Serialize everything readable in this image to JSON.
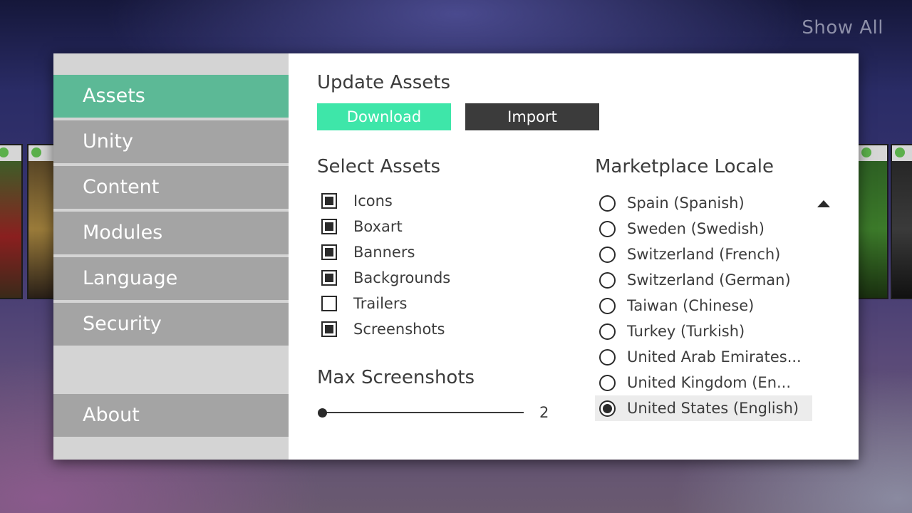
{
  "header": {
    "show_all": "Show All"
  },
  "sidebar": {
    "items": [
      {
        "label": "Assets"
      },
      {
        "label": "Unity"
      },
      {
        "label": "Content"
      },
      {
        "label": "Modules"
      },
      {
        "label": "Language"
      },
      {
        "label": "Security"
      }
    ],
    "about": "About"
  },
  "update_assets": {
    "title": "Update Assets",
    "download_label": "Download",
    "import_label": "Import"
  },
  "select_assets": {
    "title": "Select Assets",
    "items": [
      {
        "label": "Icons",
        "checked": true
      },
      {
        "label": "Boxart",
        "checked": true
      },
      {
        "label": "Banners",
        "checked": true
      },
      {
        "label": "Backgrounds",
        "checked": true
      },
      {
        "label": "Trailers",
        "checked": false
      },
      {
        "label": "Screenshots",
        "checked": true
      }
    ]
  },
  "max_screenshots": {
    "title": "Max Screenshots",
    "value": "2"
  },
  "marketplace_locale": {
    "title": "Marketplace Locale",
    "options": [
      {
        "label": "Spain (Spanish)",
        "selected": false
      },
      {
        "label": "Sweden (Swedish)",
        "selected": false
      },
      {
        "label": "Switzerland (French)",
        "selected": false
      },
      {
        "label": "Switzerland (German)",
        "selected": false
      },
      {
        "label": "Taiwan (Chinese)",
        "selected": false
      },
      {
        "label": "Turkey (Turkish)",
        "selected": false
      },
      {
        "label": "United Arab Emirates...",
        "selected": false
      },
      {
        "label": "United Kingdom (En...",
        "selected": false
      },
      {
        "label": "United States (English)",
        "selected": true
      }
    ]
  },
  "colors": {
    "accent_nav": "#5cb996",
    "accent_button": "#3ee6a9",
    "dark_button": "#3b3b3b"
  }
}
